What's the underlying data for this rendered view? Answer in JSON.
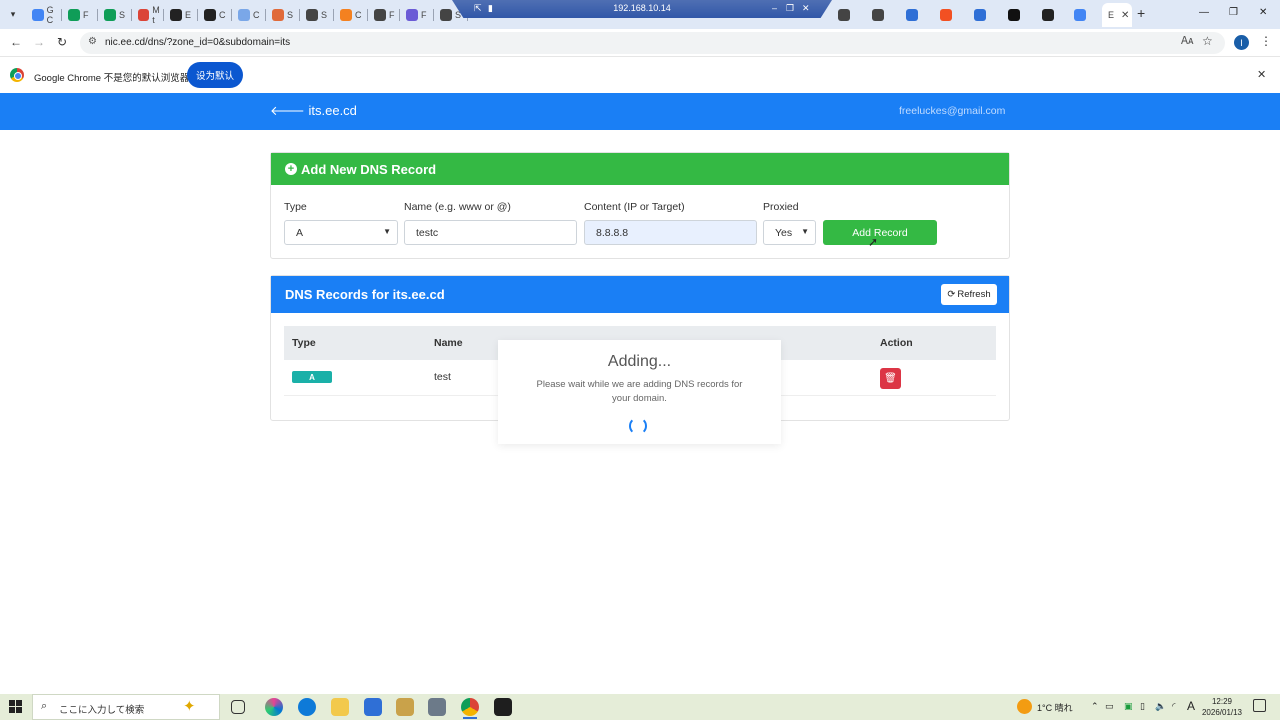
{
  "browser": {
    "tabs": [
      {
        "label": "G C",
        "color": "#4285f4"
      },
      {
        "label": "F",
        "color": "#0f9d58"
      },
      {
        "label": "S",
        "color": "#0f9d58"
      },
      {
        "label": "M t",
        "color": "#db4437"
      },
      {
        "label": "E",
        "color": "#222222"
      },
      {
        "label": "C",
        "color": "#222222"
      },
      {
        "label": "C",
        "color": "#7aa7e8"
      },
      {
        "label": "S",
        "color": "#e06a3a"
      },
      {
        "label": "S",
        "color": "#444444"
      },
      {
        "label": "C",
        "color": "#f48120"
      },
      {
        "label": "F",
        "color": "#444444"
      },
      {
        "label": "F",
        "color": "#6b5bd6"
      },
      {
        "label": "S",
        "color": "#444444"
      }
    ],
    "active_tab_label": "E",
    "remote_ip": "192.168.10.14",
    "url": "nic.ee.cd/dns/?zone_id=0&subdomain=its",
    "profile_initial": "I"
  },
  "infobar": {
    "message": "Google Chrome 不是您的默认浏览器",
    "default_button": "设为默认"
  },
  "site": {
    "back_label": "its.ee.cd",
    "user_email": "freeluckes@gmail.com"
  },
  "add_form": {
    "title": "Add New DNS Record",
    "type_label": "Type",
    "type_value": "A",
    "name_label": "Name (e.g. www or @)",
    "name_value": "testc",
    "content_label": "Content (IP or Target)",
    "content_value": "8.8.8.8",
    "proxied_label": "Proxied",
    "proxied_value": "Yes",
    "submit_label": "Add Record"
  },
  "records": {
    "title": "DNS Records for its.ee.cd",
    "refresh_label": "Refresh",
    "columns": {
      "type": "Type",
      "name": "Name",
      "action": "Action"
    },
    "rows": [
      {
        "type": "A",
        "name": "test"
      }
    ]
  },
  "modal": {
    "title": "Adding...",
    "message": "Please wait while we are adding DNS records for your domain."
  },
  "taskbar": {
    "search_placeholder": "ここに入力して検索",
    "weather": "1°C 晴れ",
    "ime": "A",
    "time": "12:29",
    "date": "2026/01/13"
  },
  "colors": {
    "primary": "#1a7ff5",
    "success": "#34b944",
    "danger": "#dc3545",
    "badge": "#1ab0a8"
  }
}
